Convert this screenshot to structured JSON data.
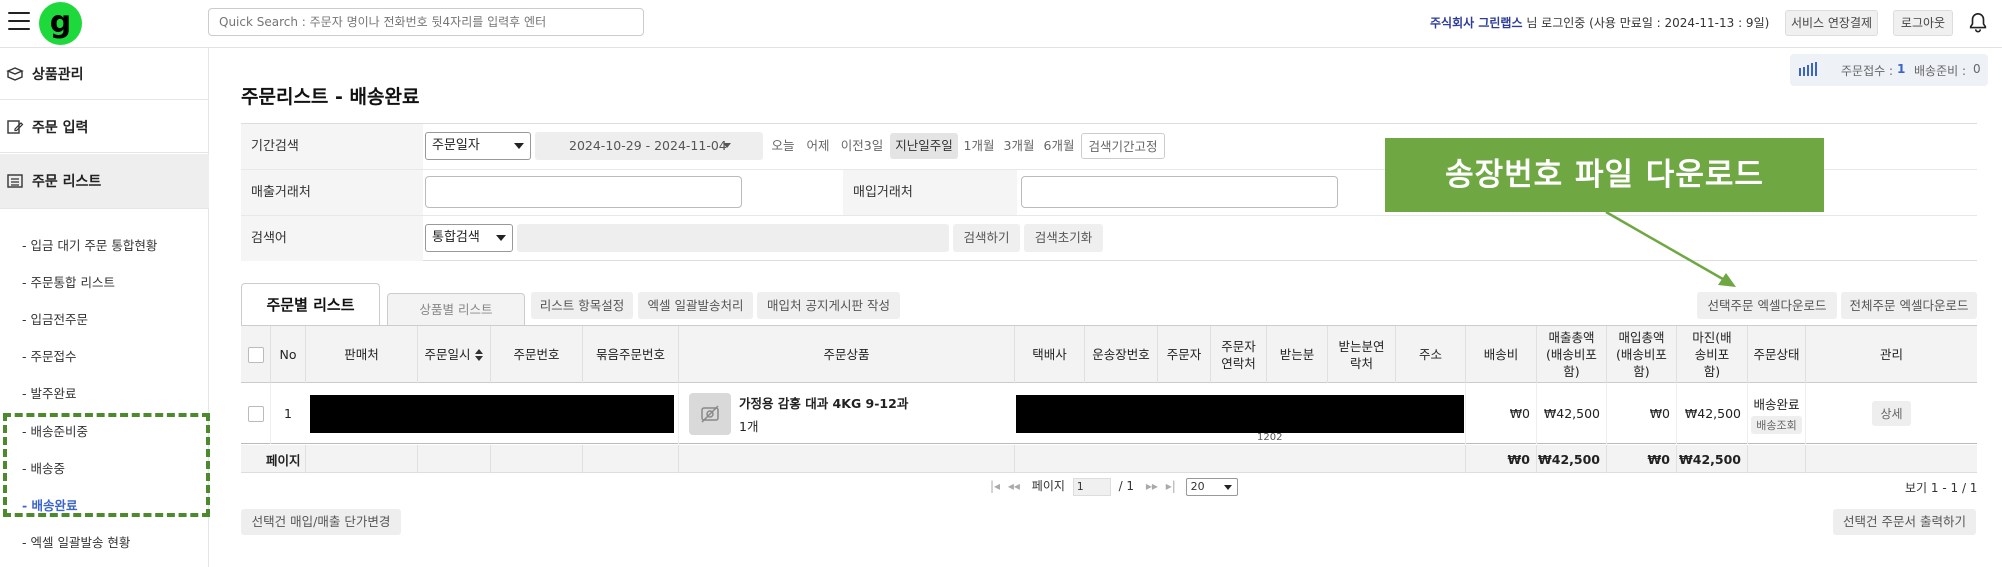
{
  "topbar": {
    "logo_letter": "g",
    "search_placeholder": "Quick Search : 주문자 명이나 전화번호 뒷4자리를 입력후 엔터",
    "company": "주식회사 그린랩스",
    "login_info": "님 로그인중 (사용 만료일 : 2024-11-13 : 9일)",
    "extend_label": "서비스 연장결제",
    "logout_label": "로그아웃"
  },
  "sidebar": {
    "menus": [
      {
        "label": "상품관리",
        "icon": "box-icon"
      },
      {
        "label": "주문 입력",
        "icon": "order-entry-icon"
      },
      {
        "label": "주문 리스트",
        "icon": "list-icon"
      }
    ],
    "sub_items": [
      "- 입금 대기 주문 통합현황",
      "- 주문통합 리스트",
      "- 입금전주문",
      "- 주문접수",
      "- 발주완료",
      "- 배송준비중",
      "- 배송중",
      "- 배송완료",
      "- 엑셀 일괄발송 현황"
    ],
    "current": "- 배송완료"
  },
  "status": {
    "received_label": "주문접수 :",
    "received_value": "1",
    "prep_label": "배송준비 :",
    "prep_value": "0"
  },
  "page": {
    "title": "주문리스트 - 배송완료"
  },
  "filters": {
    "period_label": "기간검색",
    "date_type": "주문일자",
    "date_range": "2024-10-29 - 2024-11-04",
    "quick": [
      "오늘",
      "어제",
      "이전3일",
      "지난일주일",
      "1개월",
      "3개월",
      "6개월"
    ],
    "quick_active": "지난일주일",
    "fix_label": "검색기간고정",
    "sales_label": "매출거래처",
    "purchase_label": "매입거래처",
    "keyword_label": "검색어",
    "keyword_type": "통합검색",
    "search_btn": "검색하기",
    "reset_btn": "검색초기화"
  },
  "annotation": {
    "text": "송장번호 파일 다운로드",
    "color": "#6fa843"
  },
  "tabs": {
    "tab1": "주문별 리스트",
    "tab2": "상품별 리스트",
    "actions": [
      "리스트 항목설정",
      "엑셀 일괄발송처리",
      "매입처 공지게시판 작성"
    ],
    "download_selected": "선택주문 엑셀다운로드",
    "download_all": "전체주문 엑셀다운로드"
  },
  "table": {
    "headers": [
      "No",
      "판매처",
      "주문일시",
      "주문번호",
      "묶음주문번호",
      "주문상품",
      "택배사",
      "운송장번호",
      "주문자",
      "주문자연락처",
      "받는분",
      "받는분연락처",
      "주소",
      "배송비",
      "매출총액(배송비포함)",
      "매입총액(배송비포함)",
      "마진(배송비포함)",
      "주문상태",
      "관리"
    ],
    "row": {
      "no": "1",
      "product_name": "가정용 감홍 대과 4KG 9-12과",
      "qty": "1개",
      "ship_fee": "₩0",
      "sales_total": "₩42,500",
      "purchase_total": "₩0",
      "margin": "₩42,500",
      "status": "배송완료",
      "status_btn": "배송조회",
      "manage": "상세",
      "phone_fragment": "1202"
    },
    "summary": {
      "label": "페이지",
      "ship_fee": "₩0",
      "sales_total": "₩42,500",
      "purchase_total": "₩0",
      "margin": "₩42,500"
    }
  },
  "pager": {
    "page_label": "페이지",
    "page": "1",
    "of": "/ 1",
    "per_page": "20",
    "count": "보기 1 - 1 / 1"
  },
  "bottom": {
    "left_btn": "선택건 매입/매출 단가변경",
    "right_btn": "선택건 주문서 출력하기"
  }
}
